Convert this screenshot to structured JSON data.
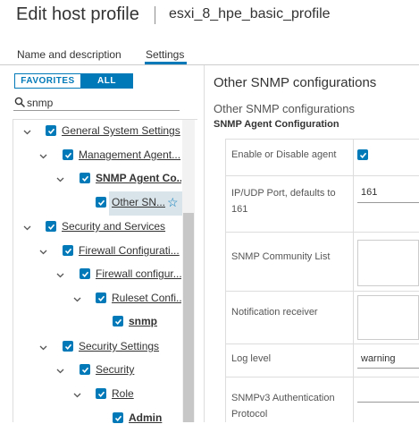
{
  "header": {
    "title": "Edit host profile",
    "profile_name": "esxi_8_hpe_basic_profile"
  },
  "tabs": [
    {
      "label": "Name and description",
      "active": false
    },
    {
      "label": "Settings",
      "active": true
    }
  ],
  "filter": {
    "favorites_label": "FAVORITES",
    "all_label": "ALL",
    "selected": "ALL"
  },
  "search": {
    "value": "snmp",
    "icon": "search-icon"
  },
  "tree": [
    {
      "label": "General System Settings",
      "level": 0,
      "checked": true,
      "expanded": true,
      "bold": false
    },
    {
      "label": "Management Agent...",
      "level": 1,
      "checked": true,
      "expanded": true,
      "bold": false
    },
    {
      "label": "SNMP Agent Co...",
      "level": 2,
      "checked": true,
      "expanded": true,
      "bold": true
    },
    {
      "label": "Other SN...",
      "level": 3,
      "checked": true,
      "selected": true,
      "bold": false
    },
    {
      "label": "Security and Services",
      "level": 0,
      "checked": true,
      "expanded": true,
      "bold": false
    },
    {
      "label": "Firewall Configurati...",
      "level": 1,
      "checked": true,
      "expanded": true,
      "bold": false
    },
    {
      "label": "Firewall configur...",
      "level": 2,
      "checked": true,
      "expanded": true,
      "bold": false
    },
    {
      "label": "Ruleset Confi...",
      "level": 3,
      "checked": true,
      "expanded": true,
      "bold": false
    },
    {
      "label": "snmp",
      "level": 4,
      "checked": true,
      "bold": true
    },
    {
      "label": "Security Settings",
      "level": 1,
      "checked": true,
      "expanded": true,
      "bold": false
    },
    {
      "label": "Security",
      "level": 2,
      "checked": true,
      "expanded": true,
      "bold": false
    },
    {
      "label": "Role",
      "level": 3,
      "checked": true,
      "expanded": true,
      "bold": false
    },
    {
      "label": "Admin",
      "level": 4,
      "checked": true,
      "bold": true
    }
  ],
  "detail": {
    "heading": "Other SNMP configurations",
    "subheading": "Other SNMP configurations",
    "group_label": "SNMP Agent Configuration",
    "fields": [
      {
        "label": "Enable or Disable agent",
        "type": "checkbox",
        "value": true
      },
      {
        "label": "IP/UDP Port, defaults to 161",
        "type": "text",
        "value": "161"
      },
      {
        "label": "SNMP Community List",
        "type": "textarea",
        "value": ""
      },
      {
        "label": "Notification receiver",
        "type": "textarea",
        "value": ""
      },
      {
        "label": "Log level",
        "type": "select",
        "value": "warning"
      },
      {
        "label": "SNMPv3 Authentication Protocol",
        "type": "text",
        "value": ""
      }
    ]
  },
  "colors": {
    "accent": "#0079b8",
    "selected_row": "#d9e4ea"
  }
}
